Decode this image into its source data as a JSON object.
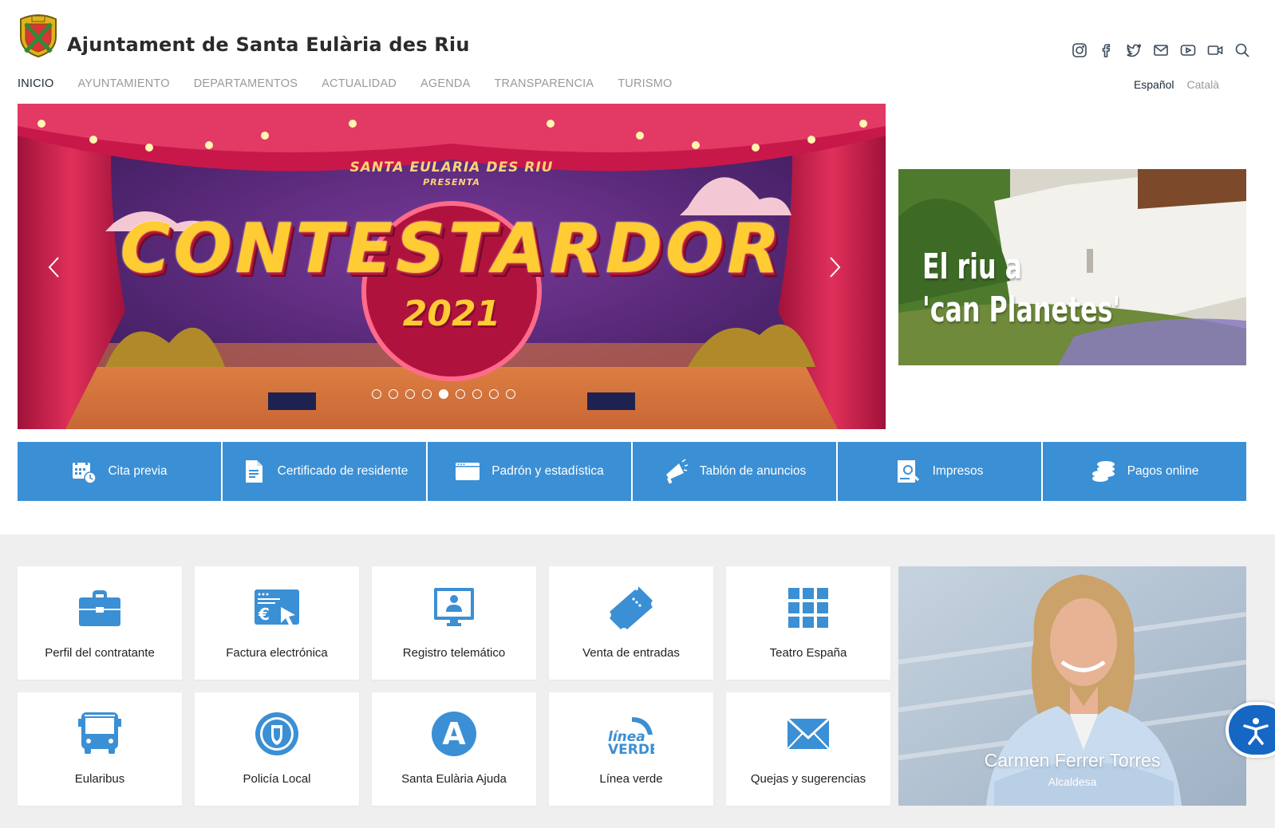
{
  "site": {
    "title": "Ajuntament de Santa Eulària des Riu"
  },
  "social_icons": [
    "instagram-icon",
    "facebook-icon",
    "twitter-icon",
    "mail-icon",
    "youtube-icon",
    "video-icon",
    "search-icon"
  ],
  "nav": {
    "items": [
      {
        "label": "INICIO",
        "active": true
      },
      {
        "label": "AYUNTAMIENTO"
      },
      {
        "label": "DEPARTAMENTOS"
      },
      {
        "label": "ACTUALIDAD"
      },
      {
        "label": "AGENDA"
      },
      {
        "label": "TRANSPARENCIA"
      },
      {
        "label": "TURISMO"
      }
    ]
  },
  "languages": [
    {
      "label": "Español",
      "active": true
    },
    {
      "label": "Català"
    }
  ],
  "slider": {
    "presenter": "SANTA EULARIA DES RIU",
    "presenter_sub": "PRESENTA",
    "title": "CONTESTARDOR",
    "year": "2021",
    "dot_count": 9,
    "active_dot": 5
  },
  "promo": {
    "line1": "El riu a",
    "line2": "'can Planetes'"
  },
  "quick_links": [
    {
      "label": "Cita previa",
      "icon": "calendar-clock-icon"
    },
    {
      "label": "Certificado de residente",
      "icon": "document-icon"
    },
    {
      "label": "Padrón y estadística",
      "icon": "browser-window-icon"
    },
    {
      "label": "Tablón de anuncios",
      "icon": "megaphone-icon"
    },
    {
      "label": "Impresos",
      "icon": "document-search-icon"
    },
    {
      "label": "Pagos online",
      "icon": "coins-icon"
    }
  ],
  "services": [
    {
      "label": "Perfil del contratante",
      "icon": "briefcase-icon"
    },
    {
      "label": "Factura electrónica",
      "icon": "e-invoice-icon"
    },
    {
      "label": "Registro telemático",
      "icon": "computer-user-icon"
    },
    {
      "label": "Venta de entradas",
      "icon": "ticket-icon"
    },
    {
      "label": "Teatro España",
      "icon": "grid-icon"
    },
    {
      "label": "Eularibus",
      "icon": "bus-icon"
    },
    {
      "label": "Policía Local",
      "icon": "police-badge-icon"
    },
    {
      "label": "Santa Eulària Ajuda",
      "icon": "letter-a-icon"
    },
    {
      "label": "Línea verde",
      "icon": "linea-verde-logo"
    },
    {
      "label": "Quejas y sugerencias",
      "icon": "envelope-icon"
    }
  ],
  "mayor": {
    "name": "Carmen Ferrer Torres",
    "role": "Alcaldesa"
  },
  "colors": {
    "accent": "#3b8fd4",
    "accessibility": "#1667c4",
    "background_band": "#efefef"
  }
}
